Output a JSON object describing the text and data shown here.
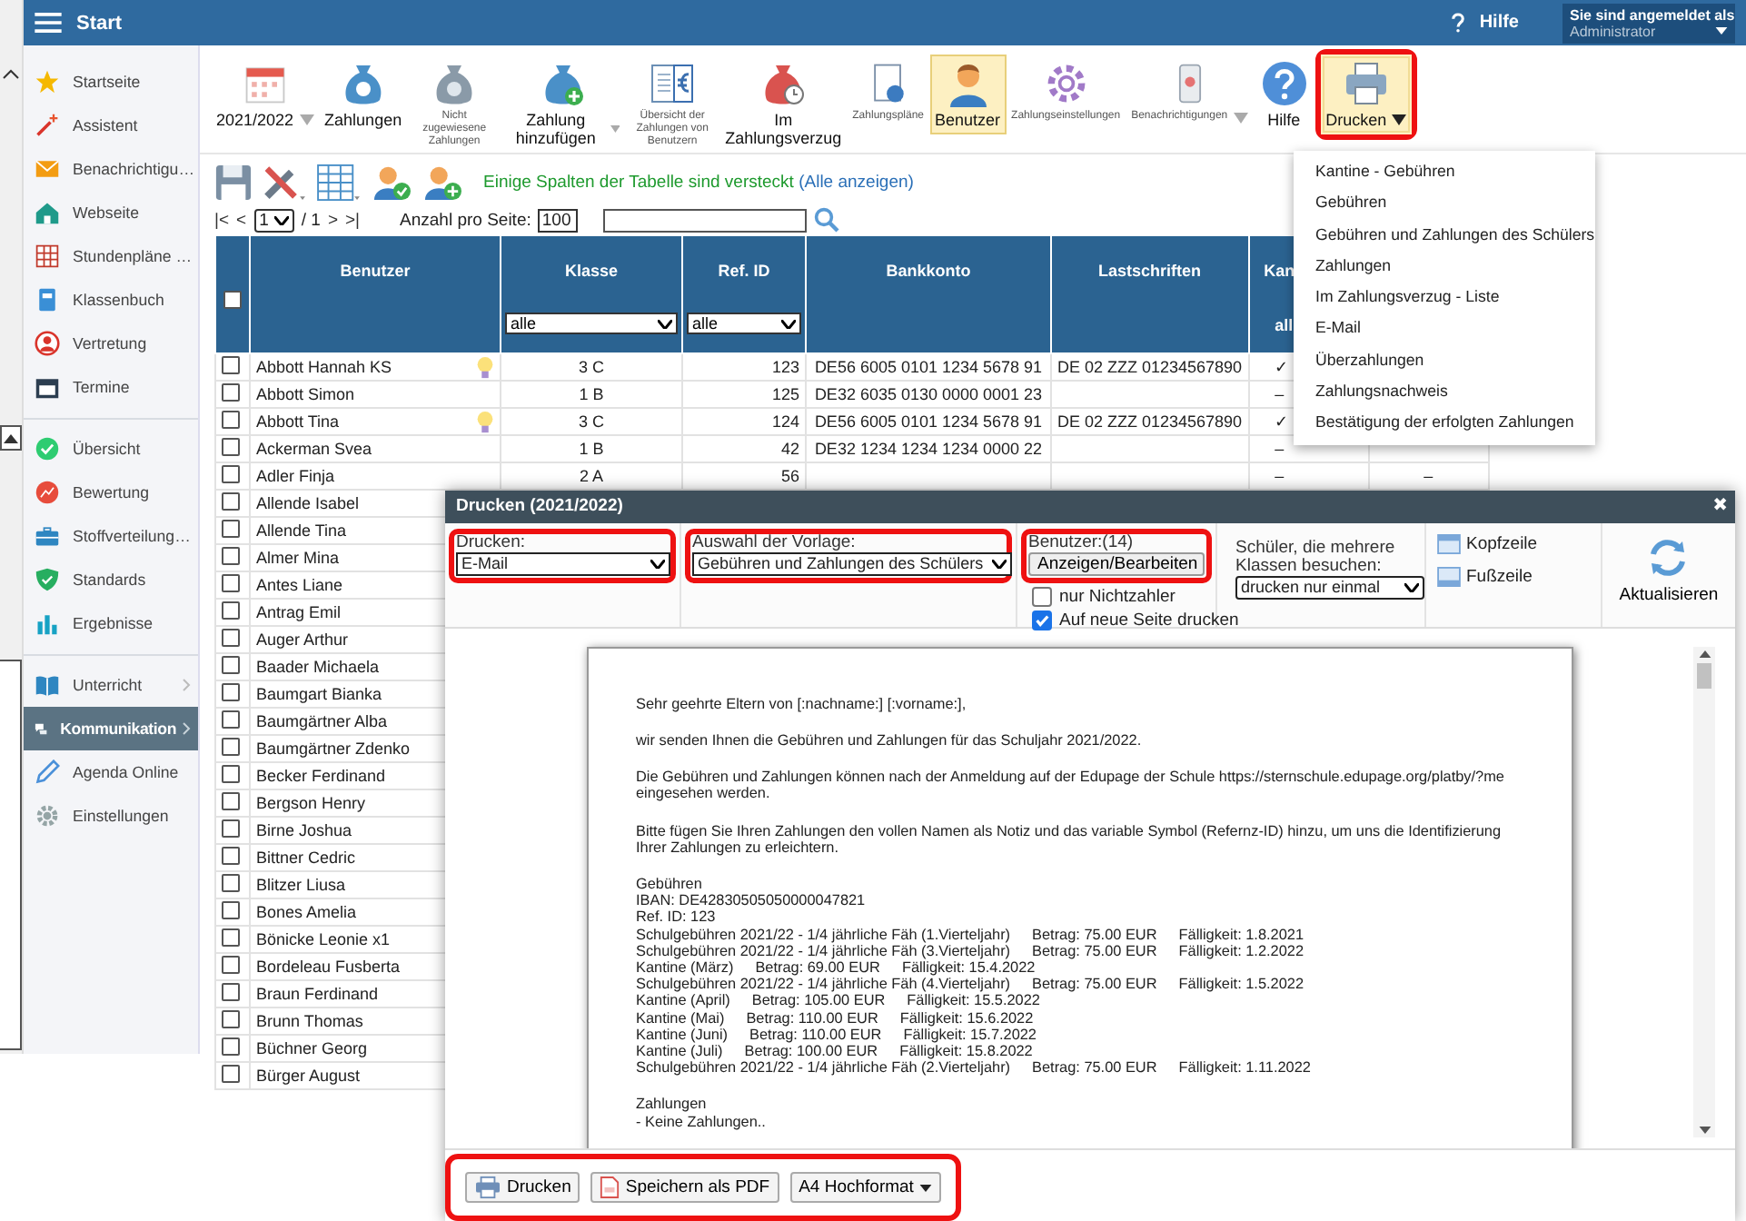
{
  "topbar": {
    "menu_label": "Start",
    "help": "Hilfe",
    "user_caption": "Sie sind angemeldet als",
    "user_name": "Administrator"
  },
  "sidebar": {
    "groups": [
      {
        "items": [
          {
            "label": "Startseite",
            "selected": false,
            "expandable": false
          },
          {
            "label": "Assistent",
            "selected": false,
            "expandable": false
          },
          {
            "label": "Benachrichtigu…",
            "selected": false,
            "expandable": false
          },
          {
            "label": "Webseite",
            "selected": false,
            "expandable": false
          },
          {
            "label": "Stundenpläne …",
            "selected": false,
            "expandable": false
          },
          {
            "label": "Klassenbuch",
            "selected": false,
            "expandable": false
          },
          {
            "label": "Vertretung",
            "selected": false,
            "expandable": false
          },
          {
            "label": "Termine",
            "selected": false,
            "expandable": false
          }
        ]
      },
      {
        "items": [
          {
            "label": "Übersicht",
            "selected": false,
            "expandable": false
          },
          {
            "label": "Bewertung",
            "selected": false,
            "expandable": false
          },
          {
            "label": "Stoffverteilung…",
            "selected": false,
            "expandable": false
          },
          {
            "label": "Standards",
            "selected": false,
            "expandable": false
          },
          {
            "label": "Ergebnisse",
            "selected": false,
            "expandable": false
          }
        ]
      },
      {
        "items": [
          {
            "label": "Unterricht",
            "selected": false,
            "expandable": true
          },
          {
            "label": "Kommunikation",
            "selected": true,
            "expandable": true
          },
          {
            "label": "Agenda Online",
            "selected": false,
            "expandable": false
          },
          {
            "label": "Einstellungen",
            "selected": false,
            "expandable": false
          }
        ]
      }
    ]
  },
  "toolbar": {
    "items": [
      {
        "label": "2021/2022",
        "kind": "large",
        "dropdown": true,
        "selected": false,
        "expanded": false,
        "highlighted": false
      },
      {
        "label": "Zahlungen",
        "kind": "large",
        "dropdown": false,
        "selected": false,
        "expanded": false,
        "highlighted": false
      },
      {
        "label": "Nicht zugewiesene Zahlungen",
        "kind": "small",
        "dropdown": false,
        "selected": false,
        "expanded": false,
        "highlighted": false
      },
      {
        "label": "Zahlung hinzufügen",
        "kind": "large",
        "dropdown": true,
        "selected": false,
        "expanded": false,
        "highlighted": false
      },
      {
        "label": "Übersicht der Zahlungen von Benutzern",
        "kind": "small",
        "dropdown": false,
        "selected": false,
        "expanded": false,
        "highlighted": false
      },
      {
        "label": "Im Zahlungsverzug",
        "kind": "large",
        "dropdown": false,
        "selected": false,
        "expanded": false,
        "highlighted": false
      },
      {
        "label": "Zahlungspläne",
        "kind": "small",
        "dropdown": false,
        "selected": false,
        "expanded": false,
        "highlighted": false
      },
      {
        "label": "Benutzer",
        "kind": "large",
        "dropdown": false,
        "selected": true,
        "expanded": false,
        "highlighted": false
      },
      {
        "label": "Zahlungseinstellungen",
        "kind": "small",
        "dropdown": false,
        "selected": false,
        "expanded": false,
        "highlighted": false
      },
      {
        "label": "Benachrichtigungen",
        "kind": "small",
        "dropdown": true,
        "selected": false,
        "expanded": false,
        "highlighted": false
      },
      {
        "label": "Hilfe",
        "kind": "large",
        "dropdown": false,
        "selected": false,
        "expanded": false,
        "highlighted": false
      },
      {
        "label": "Drucken",
        "kind": "large",
        "dropdown": true,
        "selected": false,
        "expanded": true,
        "highlighted": true
      }
    ]
  },
  "notice": {
    "text": "Einige Spalten der Tabelle sind versteckt",
    "link": "(Alle anzeigen)"
  },
  "pager": {
    "first": "|<",
    "prev": "<",
    "page": "1",
    "of": "/ 1",
    "next": ">",
    "last": ">|",
    "per_page_label": "Anzahl pro Seite:",
    "per_page": "100"
  },
  "table": {
    "select_all": {
      "checked": false
    },
    "columns": [
      {
        "label": "Benutzer"
      },
      {
        "label": "Klasse",
        "filter": "alle"
      },
      {
        "label": "Ref. ID",
        "filter": "alle"
      },
      {
        "label": "Bankkonto"
      },
      {
        "label": "Lastschriften"
      },
      {
        "label": "Kan",
        "filter": "all"
      },
      {}
    ],
    "rows": [
      {
        "checked": false,
        "hint": true,
        "cells": [
          "Abbott Hannah KS",
          "3 C",
          "123",
          "DE56 6005 0101 1234 5678 91",
          "DE 02 ZZZ 01234567890",
          "✓",
          ""
        ]
      },
      {
        "checked": false,
        "hint": false,
        "cells": [
          "Abbott Simon",
          "1 B",
          "125",
          "DE32 6035 0130 0000 0001 23",
          "",
          "–",
          ""
        ]
      },
      {
        "checked": false,
        "hint": true,
        "cells": [
          "Abbott Tina",
          "3 C",
          "124",
          "DE56 6005 0101 1234 5678 91",
          "DE 02 ZZZ 01234567890",
          "✓",
          ""
        ]
      },
      {
        "checked": false,
        "hint": false,
        "cells": [
          "Ackerman Svea",
          "1 B",
          "42",
          "DE32 1234 1234 1234 0000 22",
          "",
          "–",
          ""
        ]
      },
      {
        "checked": false,
        "hint": false,
        "cells": [
          "Adler Finja",
          "2 A",
          "56",
          "",
          "",
          "–",
          "–"
        ]
      },
      {
        "checked": false,
        "cells": [
          "Allende Isabel"
        ]
      },
      {
        "checked": false,
        "cells": [
          "Allende Tina"
        ]
      },
      {
        "checked": false,
        "cells": [
          "Almer Mina"
        ]
      },
      {
        "checked": false,
        "cells": [
          "Antes Liane"
        ]
      },
      {
        "checked": false,
        "cells": [
          "Antrag Emil"
        ]
      },
      {
        "checked": false,
        "cells": [
          "Auger Arthur"
        ]
      },
      {
        "checked": false,
        "cells": [
          "Baader Michaela"
        ]
      },
      {
        "checked": false,
        "cells": [
          "Baumgart Bianka"
        ]
      },
      {
        "checked": false,
        "cells": [
          "Baumgärtner Alba"
        ]
      },
      {
        "checked": false,
        "cells": [
          "Baumgärtner Zdenko"
        ]
      },
      {
        "checked": false,
        "cells": [
          "Becker Ferdinand"
        ]
      },
      {
        "checked": false,
        "cells": [
          "Bergson Henry"
        ]
      },
      {
        "checked": false,
        "cells": [
          "Birne Joshua"
        ]
      },
      {
        "checked": false,
        "cells": [
          "Bittner Cedric"
        ]
      },
      {
        "checked": false,
        "cells": [
          "Blitzer Liusa"
        ]
      },
      {
        "checked": false,
        "cells": [
          "Bones Amelia"
        ]
      },
      {
        "checked": false,
        "cells": [
          "Bönicke Leonie x1"
        ]
      },
      {
        "checked": false,
        "cells": [
          "Bordeleau Fusberta"
        ]
      },
      {
        "checked": false,
        "cells": [
          "Braun Ferdinand"
        ]
      },
      {
        "checked": false,
        "cells": [
          "Brunn Thomas"
        ]
      },
      {
        "checked": false,
        "cells": [
          "Büchner Georg"
        ]
      },
      {
        "checked": false,
        "cells": [
          "Bürger August"
        ]
      }
    ]
  },
  "print_menu": {
    "items": [
      "Kantine - Gebühren",
      "Gebühren",
      "Gebühren und Zahlungen des Schülers",
      "Zahlungen",
      "Im Zahlungsverzug - Liste",
      "E-Mail",
      "Überzahlungen",
      "Zahlungsnachweis",
      "Bestätigung der erfolgten Zahlungen"
    ]
  },
  "dialog": {
    "title": "Drucken (2021/2022)",
    "close": "✖",
    "print_select": {
      "label": "Drucken:",
      "value": "E-Mail",
      "highlighted": true
    },
    "template_select": {
      "label": "Auswahl der Vorlage:",
      "value": "Gebühren und Zahlungen des Schülers",
      "highlighted": true
    },
    "users": {
      "label": "Benutzer:(14)",
      "button": "Anzeigen/Bearbeiten",
      "highlighted": true
    },
    "options": [
      {
        "label": "nur Nichtzahler",
        "checked": false
      },
      {
        "label": "Auf neue Seite drucken",
        "checked": true
      }
    ],
    "multi_class": {
      "label": "Schüler, die mehrere Klassen besuchen:",
      "value": "drucken nur einmal"
    },
    "header_footer": [
      "Kopfzeile",
      "Fußzeile"
    ],
    "refresh": "Aktualisieren",
    "letter": [
      [
        [
          "Sehr geehrte Eltern von [:nachname:] [:vorname:],"
        ]
      ],
      [
        [
          "wir senden Ihnen die Gebühren und Zahlungen für das Schuljahr 2021/2022."
        ]
      ],
      [
        [
          "Die Gebühren und Zahlungen können nach der Anmeldung auf der Edupage der Schule https://sternschule.edupage.org/platby/?me"
        ],
        [
          "eingesehen werden."
        ]
      ],
      [
        [
          "Bitte fügen Sie Ihren Zahlungen den vollen Namen als Notiz und das variable Symbol (Refernz-ID) hinzu, um uns die Identifizierung"
        ],
        [
          "Ihrer Zahlungen zu erleichtern."
        ]
      ],
      [
        [
          "Gebühren"
        ],
        [
          "IBAN: DE42830505050000047821"
        ],
        [
          "Ref. ID: 123"
        ],
        [
          "Schulgebühren 2021/22 - 1/4 jährliche Fäh (1.Vierteljahr)",
          "Betrag: 75.00 EUR",
          "Fälligkeit: 1.8.2021"
        ],
        [
          "Schulgebühren 2021/22 - 1/4 jährliche Fäh (3.Vierteljahr)",
          "Betrag: 75.00 EUR",
          "Fälligkeit: 1.2.2022"
        ],
        [
          "Kantine (März)",
          "Betrag: 69.00 EUR",
          "Fälligkeit: 15.4.2022"
        ],
        [
          "Schulgebühren 2021/22 - 1/4 jährliche Fäh (4.Vierteljahr)",
          "Betrag: 75.00 EUR",
          "Fälligkeit: 1.5.2022"
        ],
        [
          "Kantine (April)",
          "Betrag: 105.00 EUR",
          "Fälligkeit: 15.5.2022"
        ],
        [
          "Kantine (Mai)",
          "Betrag: 110.00 EUR",
          "Fälligkeit: 15.6.2022"
        ],
        [
          "Kantine (Juni)",
          "Betrag: 110.00 EUR",
          "Fälligkeit: 15.7.2022"
        ],
        [
          "Kantine (Juli)",
          "Betrag: 100.00 EUR",
          "Fälligkeit: 15.8.2022"
        ],
        [
          "Schulgebühren 2021/22 - 1/4 jährliche Fäh (2.Vierteljahr)",
          "Betrag: 75.00 EUR",
          "Fälligkeit: 1.11.2022"
        ]
      ],
      [
        [
          "Zahlungen"
        ],
        [
          "- Keine Zahlungen.."
        ]
      ]
    ],
    "footer": {
      "highlighted": true,
      "print": "Drucken",
      "pdf": "Speichern als PDF",
      "format": "A4 Hochformat"
    }
  }
}
